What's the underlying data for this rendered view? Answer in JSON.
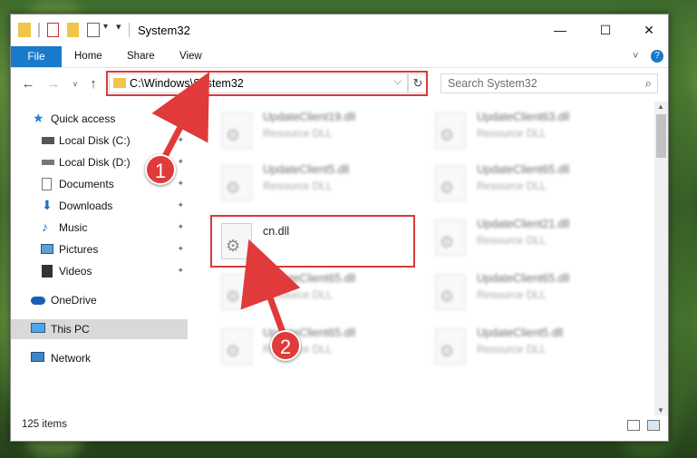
{
  "window": {
    "title": "System32",
    "controls": [
      "minimize-icon",
      "maximize-icon",
      "close-icon"
    ]
  },
  "ribbon": {
    "tabs": [
      "File",
      "Home",
      "Share",
      "View"
    ]
  },
  "address": {
    "path": "C:\\Windows\\System32",
    "search_placeholder": "Search System32"
  },
  "sidebar": {
    "items": [
      {
        "label": "Quick access",
        "icon": "star-icon"
      },
      {
        "label": "Local Disk (C:)",
        "icon": "drive-icon"
      },
      {
        "label": "Local Disk (D:)",
        "icon": "drive-icon"
      },
      {
        "label": "Documents",
        "icon": "documents-icon"
      },
      {
        "label": "Downloads",
        "icon": "downloads-icon"
      },
      {
        "label": "Music",
        "icon": "music-icon"
      },
      {
        "label": "Pictures",
        "icon": "pictures-icon"
      },
      {
        "label": "Videos",
        "icon": "videos-icon"
      },
      {
        "label": "OneDrive",
        "icon": "cloud-icon"
      },
      {
        "label": "This PC",
        "icon": "computer-icon"
      },
      {
        "label": "Network",
        "icon": "network-icon"
      }
    ]
  },
  "files": [
    {
      "name": "UpdateClient19.dll",
      "type": "Resource DLL"
    },
    {
      "name": "UpdateClient63.dll",
      "type": "Resource DLL"
    },
    {
      "name": "UpdateClient5.dll",
      "type": "Resource DLL"
    },
    {
      "name": "UpdateClient65.dll",
      "type": "Resource DLL"
    },
    {
      "name": "cn.dll",
      "type": ""
    },
    {
      "name": "UpdateClient21.dll",
      "type": "Resource DLL"
    },
    {
      "name": "UpdateClient65.dll",
      "type": "Resource DLL"
    },
    {
      "name": "UpdateClient65.dll",
      "type": "Resource DLL"
    },
    {
      "name": "UpdateClient65.dll",
      "type": "Resource DLL"
    },
    {
      "name": "UpdateClient5.dll",
      "type": "Resource DLL"
    }
  ],
  "status": {
    "item_count": "125 items"
  },
  "annotations": {
    "step1": "1",
    "step2": "2"
  },
  "colors": {
    "accent": "#1979ca",
    "highlight": "#d83a3a"
  }
}
